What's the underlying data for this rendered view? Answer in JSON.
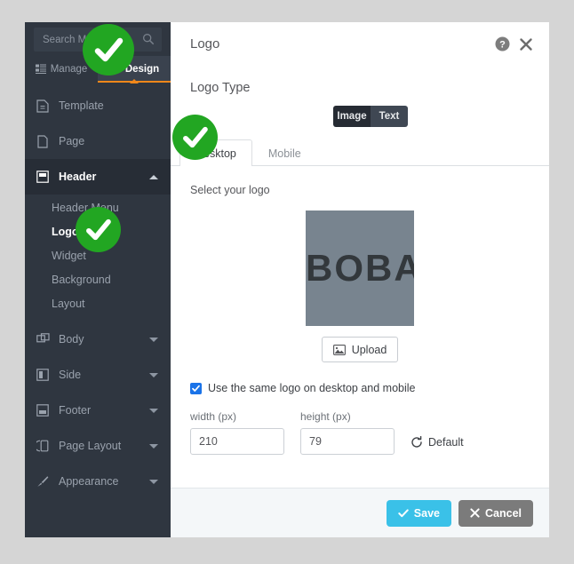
{
  "sidebar": {
    "search": {
      "placeholder": "Search Menu",
      "value": ""
    },
    "tabs": [
      {
        "label": "Manage",
        "icon": "list-icon",
        "active": false
      },
      {
        "label": "Design",
        "icon": "brush-icon",
        "active": true
      }
    ],
    "items": [
      {
        "label": "Template",
        "icon": "template-icon"
      },
      {
        "label": "Page",
        "icon": "page-icon"
      },
      {
        "label": "Header",
        "icon": "header-icon"
      },
      {
        "label": "Body",
        "icon": "body-icon"
      },
      {
        "label": "Side",
        "icon": "side-icon"
      },
      {
        "label": "Footer",
        "icon": "footer-icon"
      },
      {
        "label": "Page Layout",
        "icon": "page-layout-icon"
      },
      {
        "label": "Appearance",
        "icon": "brush-icon"
      }
    ],
    "header_subitems": [
      {
        "label": "Header Menu"
      },
      {
        "label": "Logo"
      },
      {
        "label": "Widget"
      },
      {
        "label": "Background"
      },
      {
        "label": "Layout"
      }
    ]
  },
  "panel": {
    "title": "Logo",
    "help_icon": "help-icon",
    "close_icon": "close-icon",
    "section_title": "Logo Type",
    "type_toggle": [
      {
        "label": "Image",
        "active": true
      },
      {
        "label": "Text",
        "active": false
      }
    ],
    "tabs": [
      {
        "label": "Desktop",
        "active": true
      },
      {
        "label": "Mobile",
        "active": false
      }
    ],
    "select_logo_label": "Select your logo",
    "logo_preview_text": "BOBA",
    "upload_label": "Upload",
    "upload_icon": "image-icon",
    "same_logo_checkbox": {
      "label": "Use the same logo on desktop and mobile",
      "checked": true
    },
    "width_label": "width (px)",
    "width_value": "210",
    "height_label": "height (px)",
    "height_value": "79",
    "default_label": "Default",
    "default_icon": "refresh-icon",
    "footer": {
      "save_label": "Save",
      "save_icon": "check-icon",
      "cancel_label": "Cancel",
      "cancel_icon": "x-icon"
    }
  },
  "overlays": [
    {
      "name": "green-check-1",
      "icon": "check-circle-icon"
    },
    {
      "name": "green-check-2",
      "icon": "check-circle-icon"
    },
    {
      "name": "green-check-3",
      "icon": "check-circle-icon"
    }
  ],
  "colors": {
    "sidebar_bg": "#2f3640",
    "sidebar_selected": "#272d36",
    "accent_orange": "#f0871a",
    "save_blue": "#3ac1e8",
    "cancel_gray": "#7b7b7b",
    "checkbox_blue": "#1a73e8",
    "logo_bg": "#78848f",
    "page_bg": "#d5d5d5",
    "overlay_green": "#22a622"
  }
}
